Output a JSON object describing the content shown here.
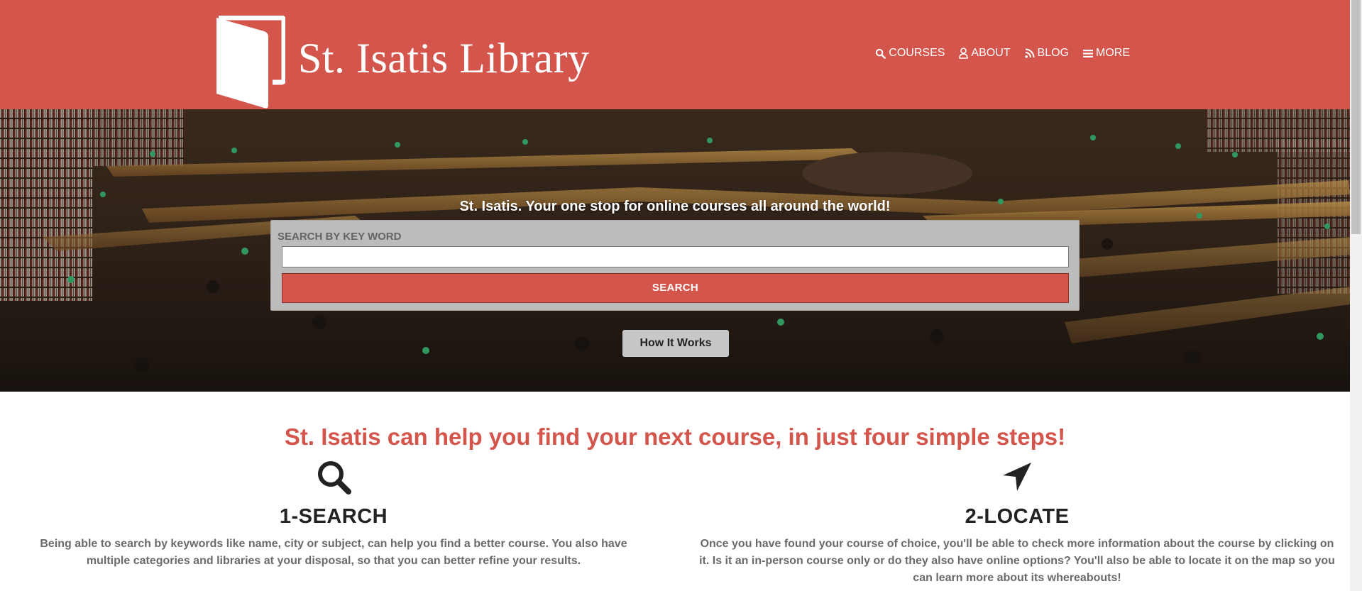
{
  "header": {
    "logo_text": "St. Isatis Library",
    "nav": [
      {
        "label": "COURSES",
        "icon": "search-icon"
      },
      {
        "label": "ABOUT",
        "icon": "user-icon"
      },
      {
        "label": "BLOG",
        "icon": "rss-icon"
      },
      {
        "label": "MORE",
        "icon": "menu-icon"
      }
    ]
  },
  "hero": {
    "tagline": "St. Isatis. Your one stop for online courses all around the world!",
    "search_label": "SEARCH BY KEY WORD",
    "search_value": "",
    "search_button": "SEARCH",
    "how_button": "How It Works"
  },
  "steps": {
    "title": "St. Isatis can help you find your next course, in just four simple steps!",
    "items": [
      {
        "icon": "search-icon",
        "title": "1-SEARCH",
        "desc": "Being able to search by keywords like name, city or subject, can help you find a better course. You also have multiple categories and libraries at your disposal, so that you can better refine your results."
      },
      {
        "icon": "location-arrow-icon",
        "title": "2-LOCATE",
        "desc": "Once you have found your course of choice, you'll be able to check more information about the course by clicking on it. Is it an in-person course only or do they also have online options? You'll also be able to locate it on the map so you can learn more about its whereabouts!"
      }
    ]
  },
  "colors": {
    "brand": "#d4554b",
    "search_box": "#bcbcbc",
    "text_dark": "#222222",
    "text_muted": "#6a6a6a"
  }
}
